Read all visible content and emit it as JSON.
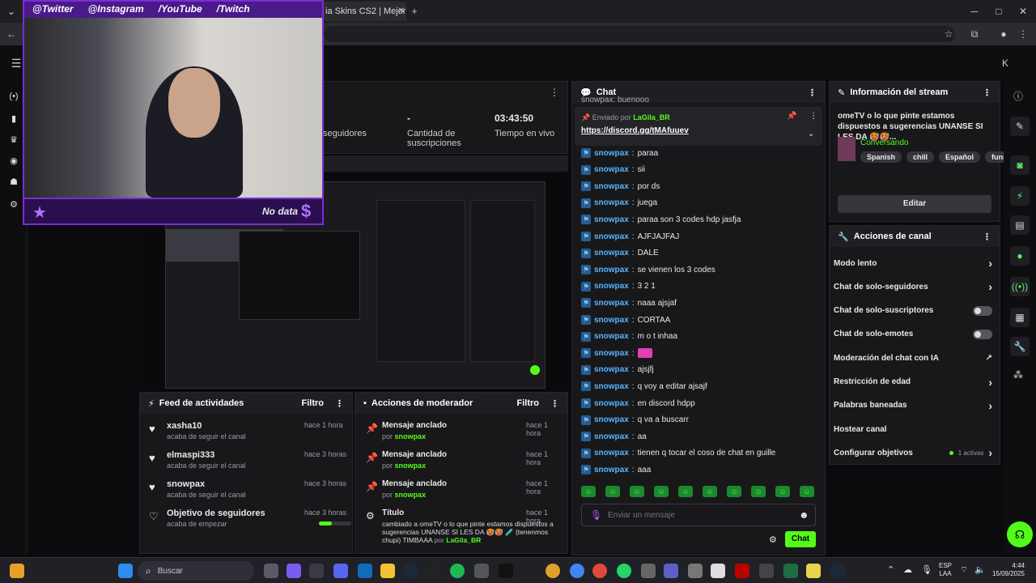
{
  "browser": {
    "tab_title": "ia Skins CS2 | Mejor",
    "new_tab": "+",
    "minimize": "─",
    "maximize": "□",
    "close": "✕"
  },
  "webcam": {
    "socials": [
      "@Twitter",
      "@Instagram",
      "/YouTube",
      "/Twitch"
    ],
    "footer_text": "No data",
    "footer_symbol": "$"
  },
  "stats": {
    "followers_label": "seguidores",
    "subs_value": "-",
    "subs_label": "Cantidad de suscripciones",
    "live_value": "03:43:50",
    "live_label": "Tiempo en vivo"
  },
  "chat": {
    "title": "Chat",
    "pinned_by_prefix": "Enviado por",
    "pinned_by_user": "LaGila_BR",
    "pinned_link": "https://discord.gg/tMAfuuev",
    "top_partial": "snowpax: buenooo",
    "messages": [
      {
        "user": "snowpax",
        "text": "paraa"
      },
      {
        "user": "snowpax",
        "text": "sii"
      },
      {
        "user": "snowpax",
        "text": "por ds"
      },
      {
        "user": "snowpax",
        "text": "juega"
      },
      {
        "user": "snowpax",
        "text": "paraa son 3 codes hdp jasfja"
      },
      {
        "user": "snowpax",
        "text": "AJFJAJFAJ"
      },
      {
        "user": "snowpax",
        "text": "DALE"
      },
      {
        "user": "snowpax",
        "text": "se vienen los 3 codes"
      },
      {
        "user": "snowpax",
        "text": "3 2 1"
      },
      {
        "user": "snowpax",
        "text": "naaa ajsjaf"
      },
      {
        "user": "snowpax",
        "text": "CORTAA"
      },
      {
        "user": "snowpax",
        "text": "m o t inhaa"
      },
      {
        "user": "snowpax",
        "text": ""
      },
      {
        "user": "snowpax",
        "text": "ajsjfj"
      },
      {
        "user": "snowpax",
        "text": "q voy a editar ajsajf"
      },
      {
        "user": "snowpax",
        "text": "en discord hdpp"
      },
      {
        "user": "snowpax",
        "text": "q va a buscarr"
      },
      {
        "user": "snowpax",
        "text": "aa"
      },
      {
        "user": "snowpax",
        "text": "tienen q tocar el coso de chat en guille"
      },
      {
        "user": "snowpax",
        "text": "aaa"
      }
    ],
    "input_placeholder": "Enviar un mensaje",
    "send_label": "Chat"
  },
  "stream_info": {
    "title": "Información del stream",
    "stream_title": "omeTV o lo que pinte estamos dispuestos a sugerencias UNANSE SI LES DA 🥵🥵...",
    "category": "Conversando",
    "tags": [
      "Spanish",
      "chill",
      "Español",
      "funny"
    ],
    "edit_label": "Editar"
  },
  "channel_actions": {
    "title": "Acciones de canal",
    "items": [
      {
        "label": "Modo lento",
        "control": "chevron"
      },
      {
        "label": "Chat de solo-seguidores",
        "control": "chevron"
      },
      {
        "label": "Chat de solo-suscriptores",
        "control": "toggle"
      },
      {
        "label": "Chat de solo-emotes",
        "control": "toggle"
      },
      {
        "label": "Moderación del chat con IA",
        "control": "external"
      },
      {
        "label": "Restricción de edad",
        "control": "chevron"
      },
      {
        "label": "Palabras baneadas",
        "control": "chevron"
      },
      {
        "label": "Hostear canal",
        "control": "none"
      },
      {
        "label": "Configurar objetivos",
        "control": "chevron"
      }
    ],
    "goals_active": "1 activas"
  },
  "activity_feed": {
    "title": "Feed de actividades",
    "filter": "Filtro",
    "items": [
      {
        "name": "xasha10",
        "desc": "acaba de seguir el canal",
        "time": "hace 1 hora"
      },
      {
        "name": "elmaspi333",
        "desc": "acaba de seguir el canal",
        "time": "hace 3 horas"
      },
      {
        "name": "snowpax",
        "desc": "acaba de seguir el canal",
        "time": "hace 3 horas"
      },
      {
        "name": "Objetivo de seguidores",
        "desc": "acaba de empezar",
        "time": "hace 3 horas"
      }
    ],
    "goal_progress": 0.4
  },
  "mod_actions": {
    "title": "Acciones de moderador",
    "filter": "Filtro",
    "items": [
      {
        "title": "Mensaje anclado",
        "by": "por",
        "user": "snowpax",
        "time": "hace 1 hora"
      },
      {
        "title": "Mensaje anclado",
        "by": "por",
        "user": "snowpax",
        "time": "hace 1 hora"
      },
      {
        "title": "Mensaje anclado",
        "by": "por",
        "user": "snowpax",
        "time": "hace 1 hora"
      }
    ],
    "title_change": {
      "title": "Título",
      "time": "hace 1 hora",
      "desc": "cambiado a omeTV o lo que pinte estamos dispuestos a sugerencias UNANSE SI LES DA 🥵🥵 🧪 (tenenmos chupi) TIMBAAA",
      "by": "por",
      "user": "LaGila_BR"
    }
  },
  "taskbar": {
    "search": "Buscar",
    "lang1": "ESP",
    "lang2": "LAA",
    "time": "4:44",
    "date": "15/09/2025"
  }
}
